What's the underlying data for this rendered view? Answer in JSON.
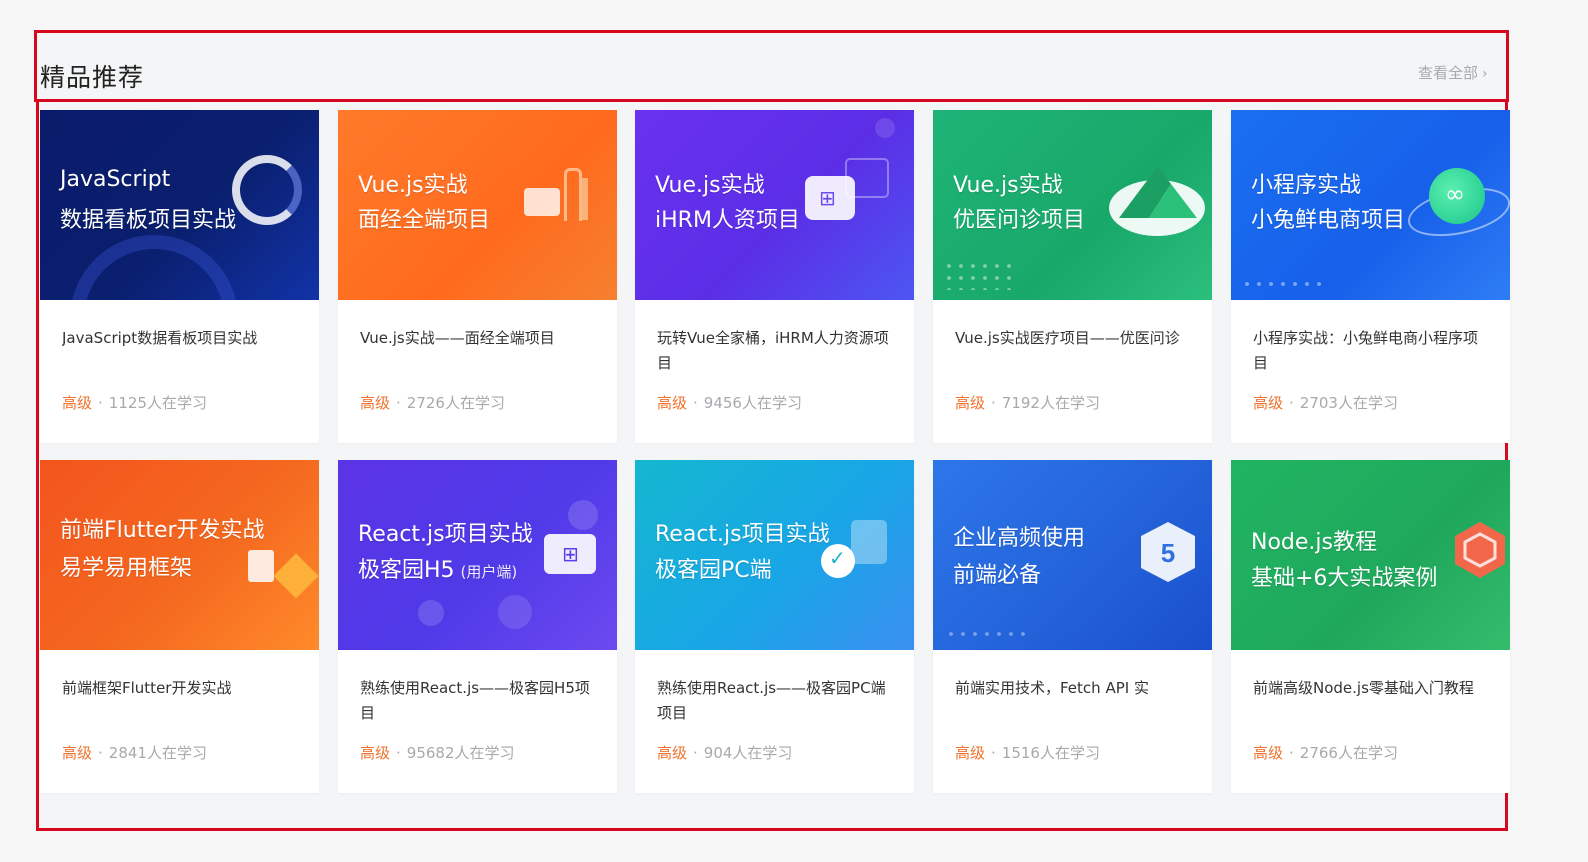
{
  "section": {
    "title": "精品推荐",
    "view_all": "查看全部",
    "view_all_icon": "chevron-right-icon"
  },
  "courses": [
    {
      "thumb_line1": "JavaScript",
      "thumb_line2": "数据看板项目实战",
      "thumb_sub": "",
      "desc": "JavaScript数据看板项目实战",
      "level": "高级",
      "learners": "1125人在学习",
      "color": "#0b1b6b",
      "icon": "ring-icon"
    },
    {
      "thumb_line1": "Vue.js实战",
      "thumb_line2": "面经全端项目",
      "thumb_sub": "",
      "desc": "Vue.js实战——面经全端项目",
      "level": "高级",
      "learners": "2726人在学习",
      "color": "#ff6a1e",
      "icon": "briefcase-icon"
    },
    {
      "thumb_line1": "Vue.js实战",
      "thumb_line2": "iHRM人资项目",
      "thumb_sub": "",
      "desc": "玩转Vue全家桶，iHRM人力资源项目",
      "level": "高级",
      "learners": "9456人在学习",
      "color": "#5b2ee6",
      "icon": "apps-icon"
    },
    {
      "thumb_line1": "Vue.js实战",
      "thumb_line2": "优医问诊项目",
      "thumb_sub": "",
      "desc": "Vue.js实战医疗项目——优医问诊",
      "level": "高级",
      "learners": "7192人在学习",
      "color": "#18a86a",
      "icon": "vue-logo-icon"
    },
    {
      "thumb_line1": "小程序实战",
      "thumb_line2": "小兔鲜电商项目",
      "thumb_sub": "",
      "desc": "小程序实战：小兔鲜电商小程序项目",
      "level": "高级",
      "learners": "2703人在学习",
      "color": "#1760ea",
      "icon": "miniprogram-icon"
    },
    {
      "thumb_line1": "前端Flutter开发实战",
      "thumb_line2": "易学易用框架",
      "thumb_sub": "",
      "desc": "前端框架Flutter开发实战",
      "level": "高级",
      "learners": "2841人在学习",
      "color": "#f4681f",
      "icon": "flutter-icon"
    },
    {
      "thumb_line1": "React.js项目实战",
      "thumb_line2": "极客园H5",
      "thumb_sub": "(用户端)",
      "desc": "熟练使用React.js——极客园H5项目",
      "level": "高级",
      "learners": "95682人在学习",
      "color": "#4f3ae8",
      "icon": "monitor-icon"
    },
    {
      "thumb_line1": "React.js项目实战",
      "thumb_line2": "极客园PC端",
      "thumb_sub": "",
      "desc": "熟练使用React.js——极客园PC端项目",
      "level": "高级",
      "learners": "904人在学习",
      "color": "#18a6e6",
      "icon": "check-badge-icon"
    },
    {
      "thumb_line1": "企业高频使用",
      "thumb_line2": "前端必备",
      "thumb_sub": "",
      "desc": "前端实用技术，Fetch API 实",
      "level": "高级",
      "learners": "1516人在学习",
      "color": "#2463da",
      "icon": "html5-icon"
    },
    {
      "thumb_line1": "Node.js教程",
      "thumb_line2": "基础+6大实战案例",
      "thumb_sub": "",
      "desc": "前端高级Node.js零基础入门教程",
      "level": "高级",
      "learners": "2766人在学习",
      "color": "#1fa85c",
      "icon": "nodejs-icon"
    }
  ]
}
